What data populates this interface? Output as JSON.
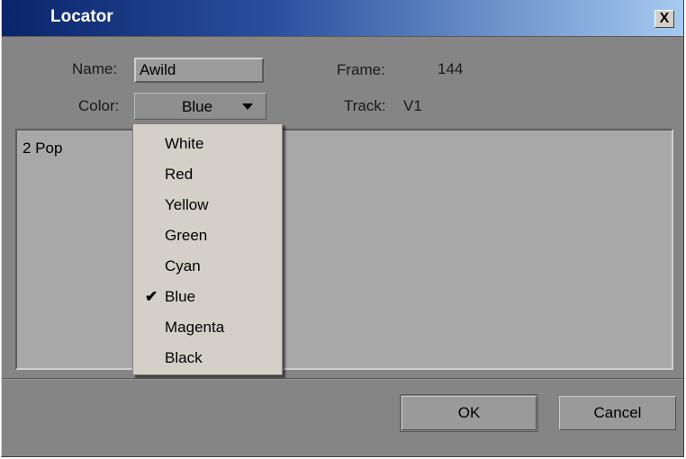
{
  "window": {
    "title": "Locator",
    "close_label": "X"
  },
  "fields": {
    "name_label": "Name:",
    "name_value": "Awild",
    "color_label": "Color:",
    "color_value": "Blue",
    "frame_label": "Frame:",
    "frame_value": "144",
    "track_label": "Track:",
    "track_value": "V1"
  },
  "comment": {
    "text": "2 Pop"
  },
  "dropdown": {
    "selected": "Blue",
    "options": [
      "White",
      "Red",
      "Yellow",
      "Green",
      "Cyan",
      "Blue",
      "Magenta",
      "Black"
    ]
  },
  "buttons": {
    "ok_label": "OK",
    "cancel_label": "Cancel"
  },
  "icons": {
    "check": "check-icon",
    "dropdown_arrow": "chevron-down-icon",
    "close": "close-icon"
  }
}
